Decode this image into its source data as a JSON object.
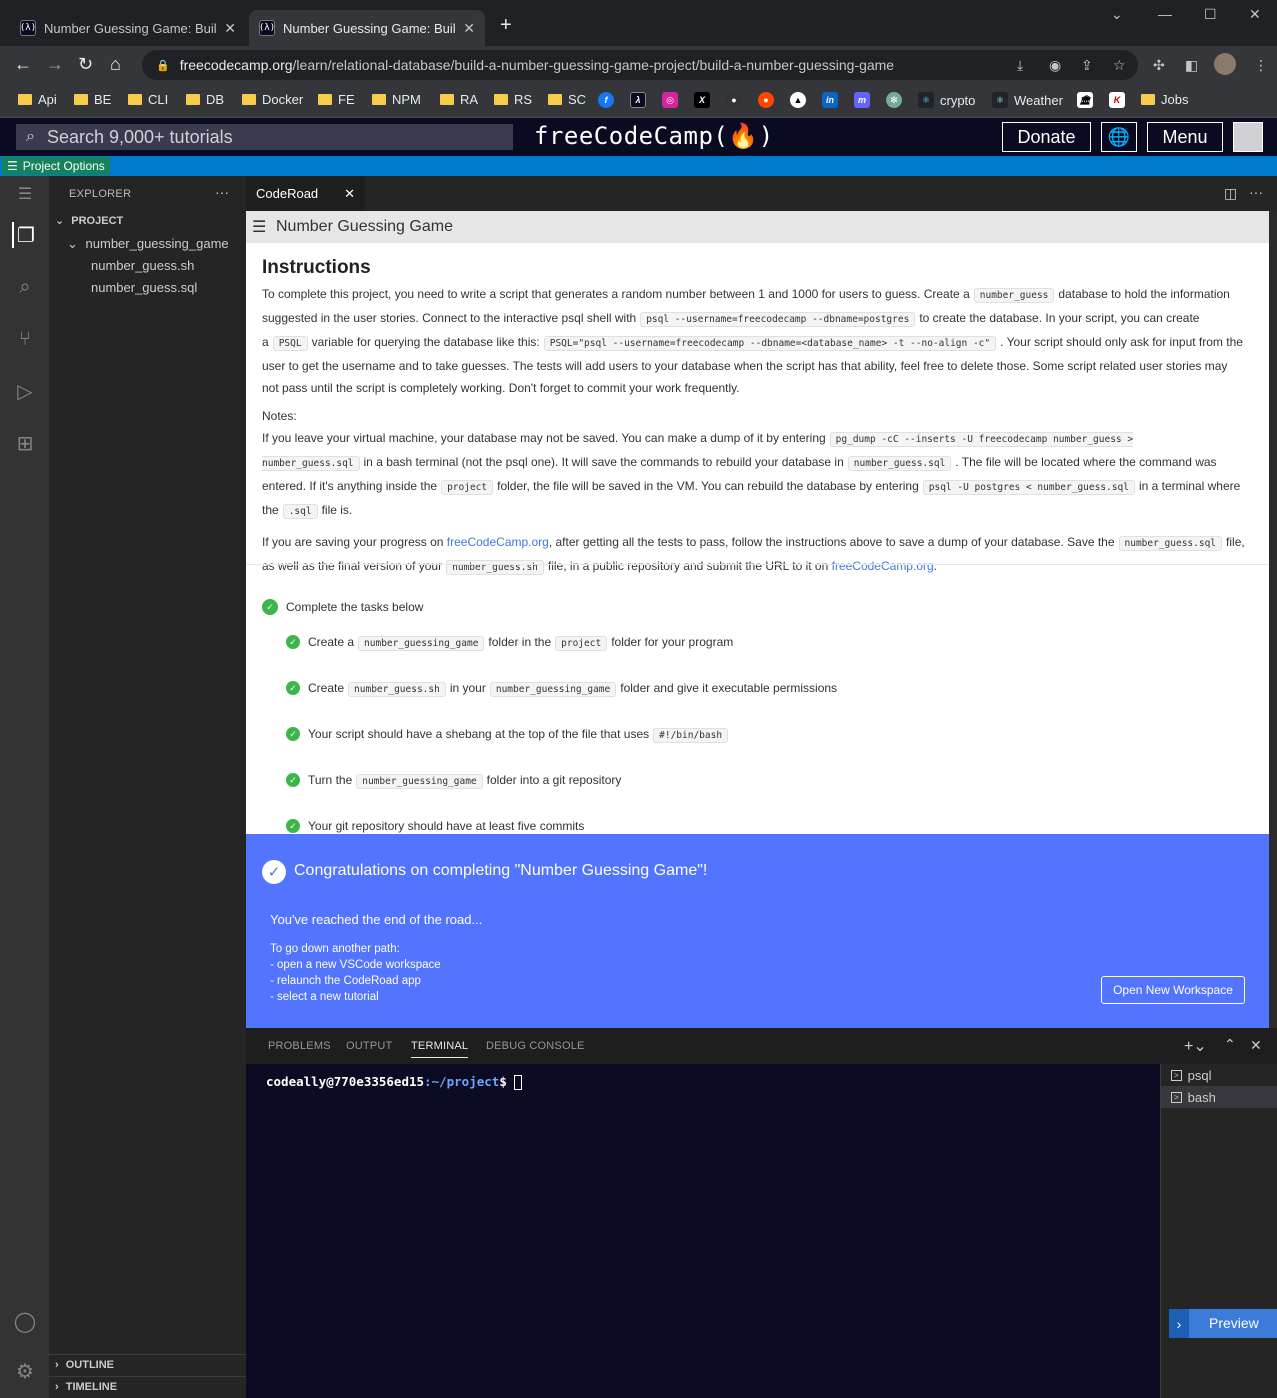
{
  "browser": {
    "tabs": [
      {
        "title": "Number Guessing Game: Build a"
      },
      {
        "title": "Number Guessing Game: Build a"
      }
    ],
    "url_host": "freecodecamp.org",
    "url_path": "/learn/relational-database/build-a-number-guessing-game-project/build-a-number-guessing-game",
    "bookmarks": [
      "Api",
      "BE",
      "CLI",
      "DB",
      "Docker",
      "FE",
      "NPM",
      "RA",
      "RS",
      "SC"
    ],
    "bookmarks_extra": [
      "crypto",
      "Weather",
      "Jobs"
    ]
  },
  "fcc": {
    "search_placeholder": "Search 9,000+ tutorials",
    "logo": "freeCodeCamp(🔥)",
    "donate": "Donate",
    "menu": "Menu"
  },
  "project_options": "Project Options",
  "explorer": {
    "title": "EXPLORER",
    "section": "PROJECT",
    "folder": "number_guessing_game",
    "files": [
      "number_guess.sh",
      "number_guess.sql"
    ],
    "outline": "OUTLINE",
    "timeline": "TIMELINE"
  },
  "editor": {
    "tab": "CodeRoad",
    "header": "Number Guessing Game",
    "instructions_title": "Instructions",
    "p1": {
      "a": "To complete this project, you need to write a script that generates a random number between 1 and 1000 for users to guess. Create a",
      "c1": "number_guess",
      "b": "database to hold the information suggested in the user stories. Connect to the interactive psql shell with",
      "c2": "psql --username=freecodecamp --dbname=postgres",
      "c": "to create the database. In your script, you can create a",
      "c3": "PSQL",
      "d": "variable for querying the database like this:",
      "c4": "PSQL=\"psql --username=freecodecamp --dbname=<database_name> -t --no-align -c\"",
      "e": ". Your script should only ask for input from the user to get the username and to take guesses. The tests will add users to your database when the script has that ability, feel free to delete those. Some script related user stories may not pass until the script is completely working. Don't forget to commit your work frequently."
    },
    "notes_label": "Notes:",
    "p2": {
      "a": "If you leave your virtual machine, your database may not be saved. You can make a dump of it by entering",
      "c1": "pg_dump -cC --inserts -U freecodecamp number_guess > number_guess.sql",
      "b": "in a bash terminal (not the psql one). It will save the commands to rebuild your database in",
      "c2": "number_guess.sql",
      "c": ". The file will be located where the command was entered. If it's anything inside the",
      "c3": "project",
      "d": "folder, the file will be saved in the VM. You can rebuild the database by entering",
      "c4": "psql -U postgres < number_guess.sql",
      "e": "in a terminal where the",
      "c5": ".sql",
      "f": "file is."
    },
    "p3": {
      "a": "If you are saving your progress on",
      "link1": "freeCodeCamp.org",
      "b": ", after getting all the tests to pass, follow the instructions above to save a dump of your database. Save the",
      "c1": "number_guess.sql",
      "c": "file, as well as the final version of your",
      "c2": "number_guess.sh",
      "d": "file, in a public repository and submit the URL to it on",
      "link2": "freeCodeCamp.org",
      "e": "."
    },
    "tasks_header": "Complete the tasks below",
    "tasks": [
      {
        "a": "Create a",
        "c1": "number_guessing_game",
        "b": "folder in the",
        "c2": "project",
        "c": "folder for your program"
      },
      {
        "a": "Create",
        "c1": "number_guess.sh",
        "b": "in your",
        "c2": "number_guessing_game",
        "c": "folder and give it executable permissions"
      },
      {
        "a": "Your script should have a shebang at the top of the file that uses",
        "c1": "#!/bin/bash",
        "b": "",
        "c2": "",
        "c": ""
      },
      {
        "a": "Turn the",
        "c1": "number_guessing_game",
        "b": "folder into a git repository",
        "c2": "",
        "c": ""
      },
      {
        "a": "Your git repository should have at least five commits",
        "c1": "",
        "b": "",
        "c2": "",
        "c": ""
      }
    ]
  },
  "congrats": {
    "title": "Congratulations on completing \"Number Guessing Game\"!",
    "end": "You've reached the end of the road...",
    "path_label": "To go down another path:",
    "options": [
      "- open a new VSCode workspace",
      "- relaunch the CodeRoad app",
      "- select a new tutorial"
    ],
    "button": "Open New Workspace"
  },
  "panel": {
    "tabs": [
      "PROBLEMS",
      "OUTPUT",
      "TERMINAL",
      "DEBUG CONSOLE"
    ],
    "active_tab": "TERMINAL",
    "prompt_user": "codeally@770e3356ed15",
    "prompt_path": ":~/project",
    "prompt_end": "$ ",
    "terminals": [
      "psql",
      "bash"
    ],
    "preview": "Preview"
  }
}
